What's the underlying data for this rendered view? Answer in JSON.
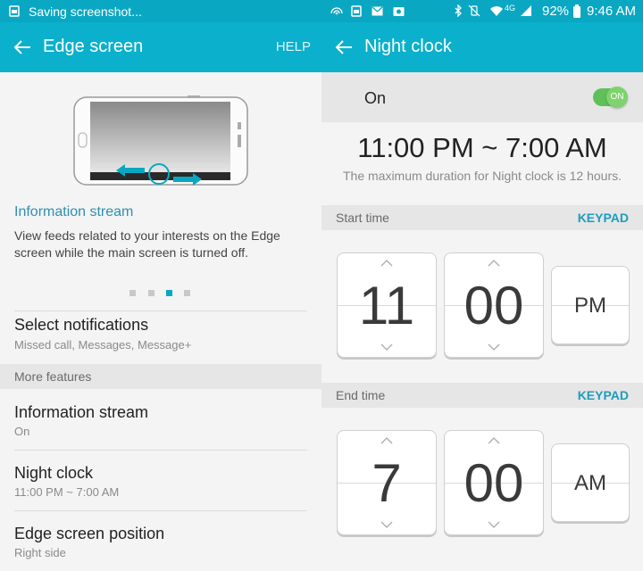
{
  "left": {
    "status": {
      "text": "Saving screenshot..."
    },
    "appbar": {
      "title": "Edge screen",
      "help_label": "HELP"
    },
    "illustration": {
      "icon": "phone-edge-swipe-illustration"
    },
    "info": {
      "title": "Information stream",
      "description": "View feeds related to your interests on the Edge screen while the main screen is turned off."
    },
    "pager": {
      "count": 4,
      "active": 2
    },
    "select_notifications": {
      "title": "Select notifications",
      "sub": "Missed call, Messages, Message+"
    },
    "section_label": "More features",
    "info_stream": {
      "title": "Information stream",
      "sub": "On"
    },
    "night_clock": {
      "title": "Night clock",
      "sub": "11:00 PM ~ 7:00 AM"
    },
    "edge_position": {
      "title": "Edge screen position",
      "sub": "Right side"
    }
  },
  "right": {
    "status": {
      "battery": "92%",
      "time": "9:46 AM",
      "network": "4G"
    },
    "appbar": {
      "title": "Night clock"
    },
    "toggle": {
      "label": "On",
      "switch_text": "ON"
    },
    "range": "11:00 PM ~ 7:00 AM",
    "note": "The maximum duration for Night clock is 12 hours.",
    "start": {
      "label": "Start time",
      "keypad": "KEYPAD",
      "hour": "11",
      "minute": "00",
      "ampm": "PM"
    },
    "end": {
      "label": "End time",
      "keypad": "KEYPAD",
      "hour": "7",
      "minute": "00",
      "ampm": "AM"
    }
  },
  "colors": {
    "accent": "#0ab0cc",
    "switch_on": "#5fc05a",
    "link": "#1b9dbd"
  }
}
